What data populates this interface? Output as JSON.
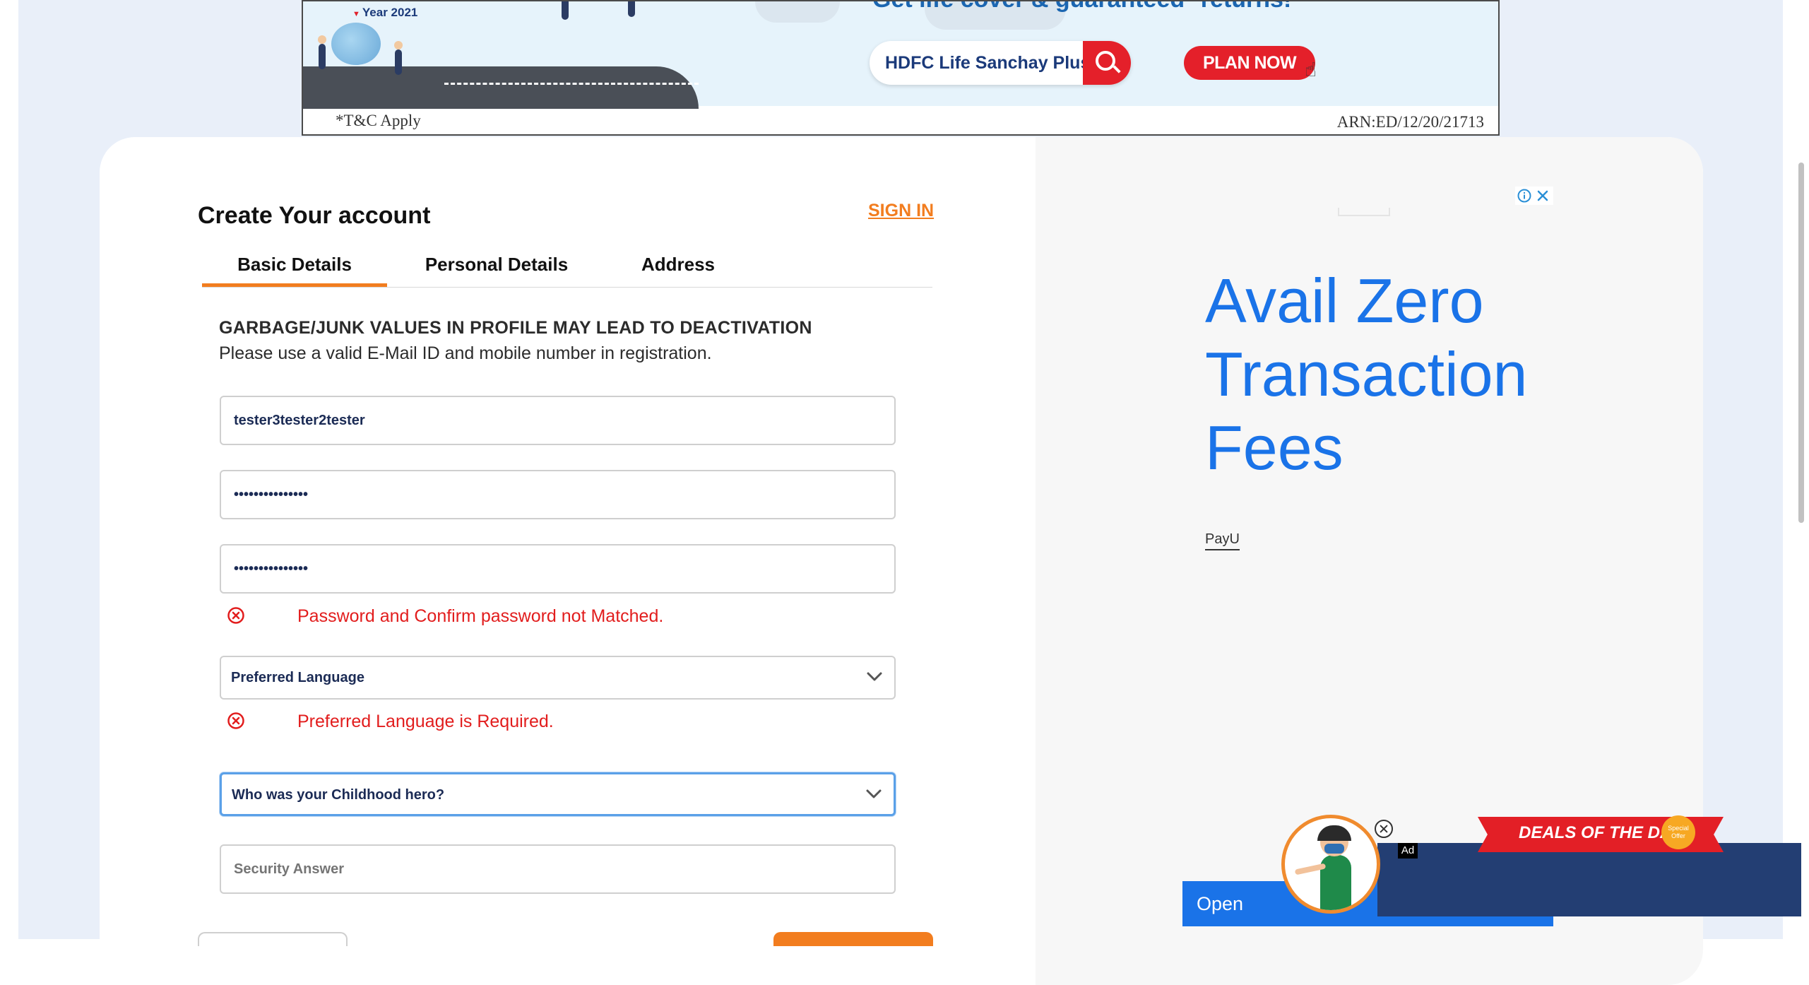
{
  "banner": {
    "year_tag": "Year 2021",
    "headline": "Get life cover & guaranteed* returns!",
    "search_text": "HDFC Life Sanchay Plus",
    "cta": "PLAN NOW",
    "tnc": "*T&C Apply",
    "arn": "ARN:ED/12/20/21713"
  },
  "form": {
    "title": "Create Your account",
    "signin": "SIGN IN",
    "tabs": [
      {
        "label": "Basic Details",
        "active": true
      },
      {
        "label": "Personal Details",
        "active": false
      },
      {
        "label": "Address",
        "active": false
      }
    ],
    "warning_heading": "GARBAGE/JUNK VALUES IN PROFILE MAY LEAD TO DEACTIVATION",
    "warning_text": "Please use a valid E-Mail ID and mobile number in registration.",
    "username_value": "tester3tester2tester",
    "password_value": "•••••••••••••••",
    "confirm_password_value": "•••••••••••••••",
    "password_error": "Password and Confirm password not Matched.",
    "language_selected": "Preferred Language",
    "language_error": "Preferred Language is Required.",
    "security_question_selected": "Who was your Childhood hero?",
    "security_answer_placeholder": "Security Answer"
  },
  "side_ad": {
    "headline_lines": [
      "Avail Zero",
      "Transaction",
      "Fees"
    ],
    "brand": "PayU",
    "open_button": "Open"
  },
  "overlay": {
    "deals_label": "DEALS OF THE DAY",
    "badge_text": "Special Offer",
    "ad_tag": "Ad"
  },
  "colors": {
    "accent": "#f27d1f",
    "error": "#e21d1d",
    "ad_blue": "#1a73e8",
    "page_bg": "#e9eff9"
  }
}
